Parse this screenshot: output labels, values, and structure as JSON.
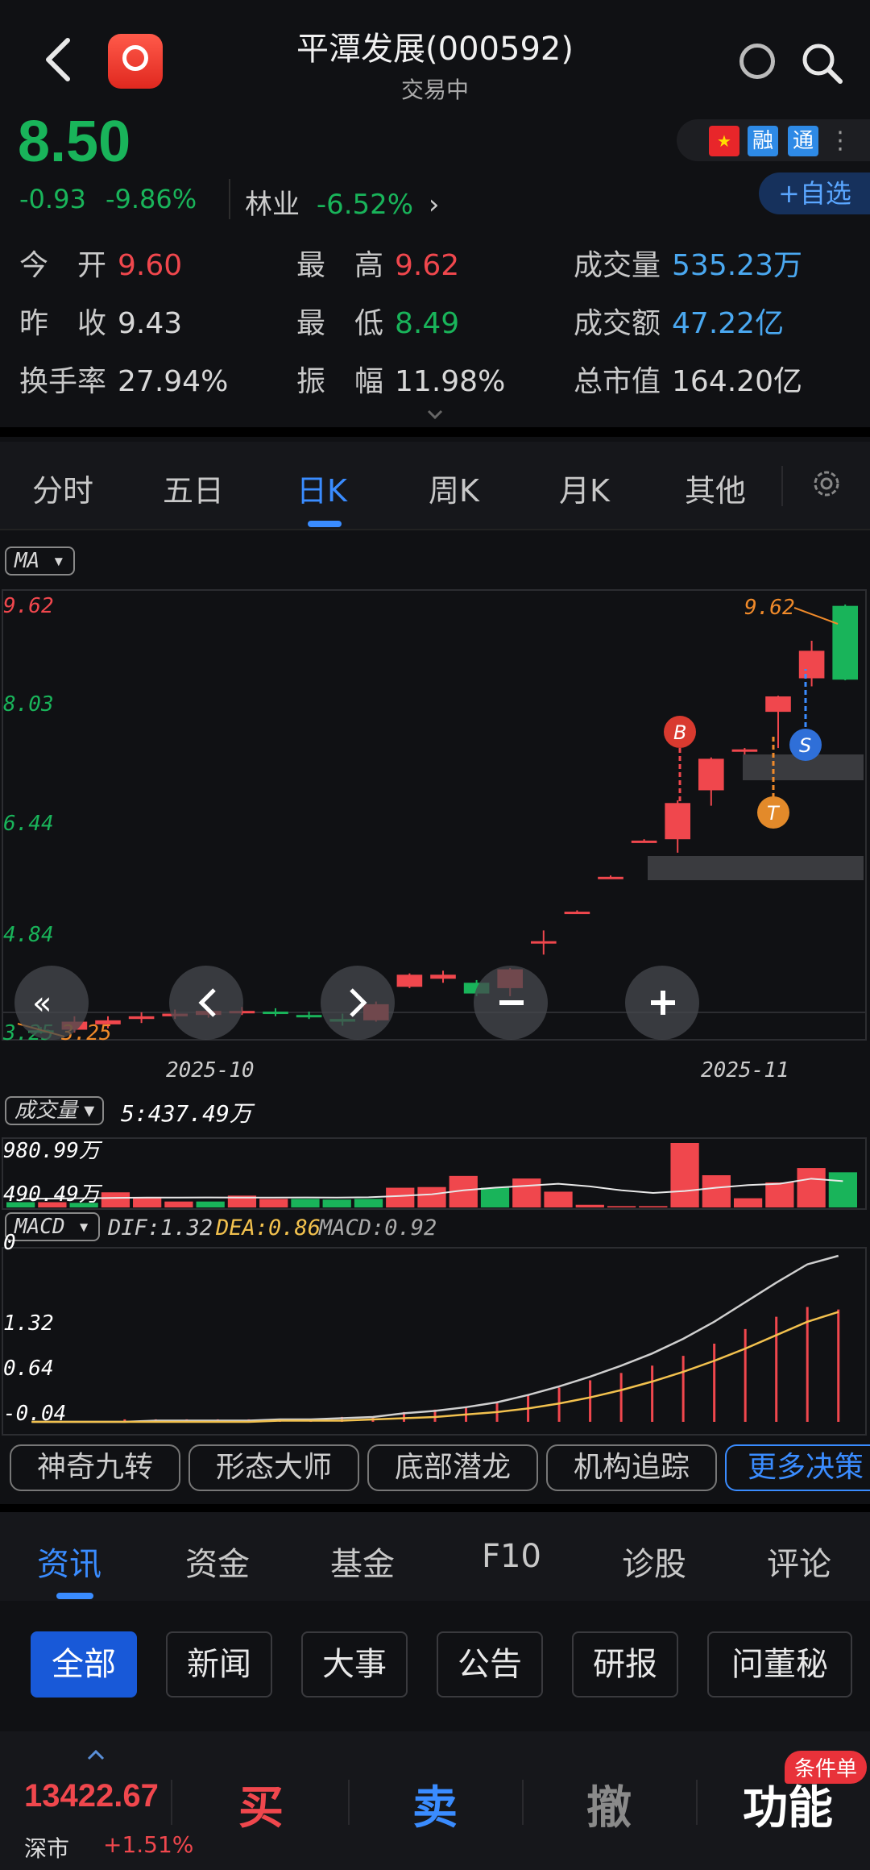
{
  "header": {
    "title": "平潭发展(000592)",
    "status": "交易中",
    "back_icon": "chevron-left-icon",
    "search_icon": "search-icon"
  },
  "quote": {
    "price": "8.50",
    "change": "-0.93",
    "change_pct": "-9.86%",
    "industry_name": "林业",
    "industry_pct": "-6.52%",
    "industry_arrow": "›",
    "tag_rong": "融",
    "tag_tong": "通",
    "add_watch": "+自选"
  },
  "stats": {
    "open_label": "今　开",
    "open": "9.60",
    "high_label": "最　高",
    "high": "9.62",
    "vol_label": "成交量",
    "vol": "535.23万",
    "prev_label": "昨　收",
    "prev": "9.43",
    "low_label": "最　低",
    "low": "8.49",
    "amt_label": "成交额",
    "amt": "47.22亿",
    "turn_label": "换手率",
    "turn": "27.94%",
    "amp_label": "振　幅",
    "amp": "11.98%",
    "cap_label": "总市值",
    "cap": "164.20亿"
  },
  "tabs": [
    "分时",
    "五日",
    "日K",
    "周K",
    "月K",
    "其他"
  ],
  "active_tab": "日K",
  "main_chart": {
    "indicator": "MA",
    "y_labels": [
      "9.62",
      "8.03",
      "6.44",
      "4.84",
      "3.25"
    ],
    "low_marker": "3.25",
    "high_marker": "9.62",
    "x_labels": [
      "2025-10",
      "2025-11"
    ],
    "signals": [
      "B",
      "T",
      "S"
    ]
  },
  "volume_chart": {
    "indicator": "成交量",
    "readout": "5:437.49万",
    "y_labels": [
      "980.99万",
      "490.49万",
      "0"
    ]
  },
  "macd_chart": {
    "indicator": "MACD",
    "dif": "DIF:1.32",
    "dea": "DEA:0.86",
    "macd": "MACD:0.92",
    "y_labels": [
      "1.32",
      "0.64",
      "-0.04"
    ]
  },
  "chart_data": {
    "type": "candlestick",
    "x_labels": [
      "2025-10",
      "2025-11"
    ],
    "ylim": [
      3.25,
      9.62
    ],
    "candles": [
      {
        "o": 3.25,
        "c": 3.27,
        "h": 3.32,
        "l": 3.22,
        "d": "down"
      },
      {
        "o": 3.28,
        "c": 3.4,
        "h": 3.48,
        "l": 3.24,
        "d": "up"
      },
      {
        "o": 3.36,
        "c": 3.42,
        "h": 3.48,
        "l": 3.3,
        "d": "up"
      },
      {
        "o": 3.44,
        "c": 3.48,
        "h": 3.54,
        "l": 3.38,
        "d": "up"
      },
      {
        "o": 3.48,
        "c": 3.52,
        "h": 3.58,
        "l": 3.44,
        "d": "up"
      },
      {
        "o": 3.5,
        "c": 3.56,
        "h": 3.62,
        "l": 3.46,
        "d": "up"
      },
      {
        "o": 3.54,
        "c": 3.56,
        "h": 3.62,
        "l": 3.5,
        "d": "up"
      },
      {
        "o": 3.55,
        "c": 3.53,
        "h": 3.6,
        "l": 3.48,
        "d": "down"
      },
      {
        "o": 3.5,
        "c": 3.48,
        "h": 3.55,
        "l": 3.44,
        "d": "down"
      },
      {
        "o": 3.44,
        "c": 3.4,
        "h": 3.52,
        "l": 3.34,
        "d": "down"
      },
      {
        "o": 3.42,
        "c": 3.66,
        "h": 3.7,
        "l": 3.4,
        "d": "up"
      },
      {
        "o": 3.92,
        "c": 4.1,
        "h": 4.12,
        "l": 3.9,
        "d": "up"
      },
      {
        "o": 4.1,
        "c": 4.04,
        "h": 4.16,
        "l": 3.98,
        "d": "up"
      },
      {
        "o": 3.98,
        "c": 3.82,
        "h": 4.02,
        "l": 3.78,
        "d": "down"
      },
      {
        "o": 3.9,
        "c": 4.18,
        "h": 4.2,
        "l": 3.78,
        "d": "up"
      },
      {
        "o": 4.6,
        "c": 4.6,
        "h": 4.76,
        "l": 4.4,
        "d": "up"
      },
      {
        "o": 5.04,
        "c": 5.04,
        "h": 5.06,
        "l": 5.02,
        "d": "up"
      },
      {
        "o": 5.56,
        "c": 5.56,
        "h": 5.58,
        "l": 5.54,
        "d": "up"
      },
      {
        "o": 6.1,
        "c": 6.1,
        "h": 6.12,
        "l": 6.08,
        "d": "up"
      },
      {
        "o": 6.12,
        "c": 6.66,
        "h": 6.7,
        "l": 5.92,
        "d": "up"
      },
      {
        "o": 6.85,
        "c": 7.32,
        "h": 7.34,
        "l": 6.62,
        "d": "up"
      },
      {
        "o": 7.46,
        "c": 7.46,
        "h": 7.48,
        "l": 7.2,
        "d": "up"
      },
      {
        "o": 8.02,
        "c": 8.25,
        "h": 8.26,
        "l": 7.48,
        "d": "up"
      },
      {
        "o": 8.52,
        "c": 8.93,
        "h": 9.08,
        "l": 8.4,
        "d": "up"
      },
      {
        "o": 9.6,
        "c": 8.5,
        "h": 9.62,
        "l": 8.49,
        "d": "down"
      }
    ],
    "volume": [
      {
        "v": 80,
        "d": "down"
      },
      {
        "v": 80,
        "d": "up"
      },
      {
        "v": 70,
        "d": "down"
      },
      {
        "v": 230,
        "d": "up"
      },
      {
        "v": 150,
        "d": "up"
      },
      {
        "v": 90,
        "d": "up"
      },
      {
        "v": 90,
        "d": "down"
      },
      {
        "v": 180,
        "d": "up"
      },
      {
        "v": 130,
        "d": "up"
      },
      {
        "v": 130,
        "d": "down"
      },
      {
        "v": 120,
        "d": "down"
      },
      {
        "v": 130,
        "d": "down"
      },
      {
        "v": 300,
        "d": "up"
      },
      {
        "v": 310,
        "d": "up"
      },
      {
        "v": 480,
        "d": "up"
      },
      {
        "v": 300,
        "d": "down"
      },
      {
        "v": 440,
        "d": "up"
      },
      {
        "v": 240,
        "d": "up"
      },
      {
        "v": 40,
        "d": "up"
      },
      {
        "v": 20,
        "d": "up"
      },
      {
        "v": 20,
        "d": "up"
      },
      {
        "v": 980.99,
        "d": "up"
      },
      {
        "v": 490,
        "d": "up"
      },
      {
        "v": 140,
        "d": "up"
      },
      {
        "v": 380,
        "d": "up"
      },
      {
        "v": 600,
        "d": "up"
      },
      {
        "v": 535.23,
        "d": "down"
      }
    ],
    "volume_ma": [
      130,
      135,
      140,
      145,
      150,
      150,
      152,
      150,
      150,
      152,
      150,
      155,
      175,
      200,
      260,
      300,
      330,
      360,
      320,
      260,
      220,
      250,
      300,
      340,
      360,
      437.49,
      400
    ],
    "macd": {
      "dif": [
        -0.04,
        -0.04,
        -0.04,
        -0.04,
        -0.03,
        -0.03,
        -0.03,
        -0.03,
        -0.02,
        -0.02,
        -0.01,
        0.0,
        0.03,
        0.05,
        0.08,
        0.12,
        0.18,
        0.25,
        0.33,
        0.42,
        0.52,
        0.64,
        0.78,
        0.94,
        1.1,
        1.25,
        1.32
      ],
      "dea": [
        -0.04,
        -0.04,
        -0.04,
        -0.04,
        -0.04,
        -0.04,
        -0.04,
        -0.04,
        -0.03,
        -0.03,
        -0.03,
        -0.02,
        -0.01,
        0.0,
        0.02,
        0.04,
        0.07,
        0.11,
        0.16,
        0.22,
        0.29,
        0.37,
        0.46,
        0.56,
        0.67,
        0.78,
        0.86
      ],
      "bar": [
        0,
        0,
        0,
        0.02,
        0.02,
        0.02,
        0.02,
        0.02,
        0.02,
        0.02,
        0.04,
        0.04,
        0.08,
        0.1,
        0.12,
        0.16,
        0.22,
        0.28,
        0.34,
        0.4,
        0.46,
        0.54,
        0.64,
        0.76,
        0.86,
        0.94,
        0.92
      ]
    }
  },
  "chart_controls": {
    "first_icon": "double-chevron-left-icon",
    "prev_icon": "chevron-left-icon",
    "next_icon": "chevron-right-icon",
    "zoom_out": "−",
    "zoom_in": "+"
  },
  "tools": [
    "神奇九转",
    "形态大师",
    "底部潜龙",
    "机构追踪",
    "更多决策"
  ],
  "info_tabs": [
    "资讯",
    "资金",
    "基金",
    "F10",
    "诊股",
    "评论"
  ],
  "filters": [
    "全部",
    "新闻",
    "大事",
    "公告",
    "研报",
    "问董秘"
  ],
  "bottom": {
    "index_value": "13422.67",
    "index_name": "深市",
    "index_change": "+1.51%",
    "buy": "买",
    "sell": "卖",
    "cancel": "撤",
    "func": "功能",
    "badge": "条件单"
  },
  "colors": {
    "up": "#f0474d",
    "down": "#19b45a",
    "accent": "#3a8cff"
  }
}
